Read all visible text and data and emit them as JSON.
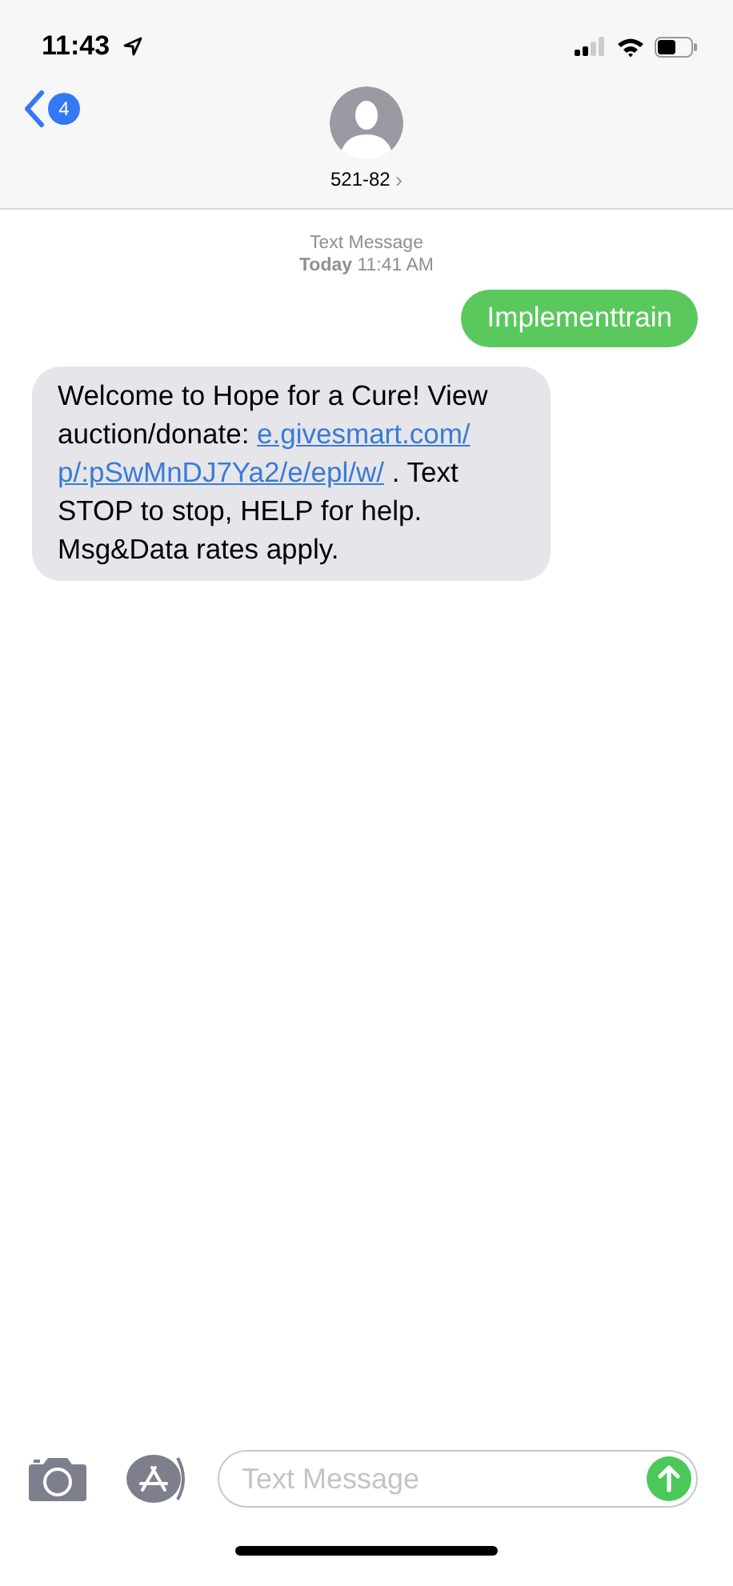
{
  "status_bar": {
    "time": "11:43"
  },
  "header": {
    "back_count": "4",
    "contact": "521-82",
    "chevron": "›"
  },
  "timestamp": {
    "service": "Text Message",
    "day": "Today",
    "time": "11:41 AM"
  },
  "messages": [
    {
      "kind": "sent",
      "parts": [
        {
          "kind": "text",
          "text": "Implementtrain"
        }
      ]
    },
    {
      "kind": "received",
      "parts": [
        {
          "kind": "text",
          "text": "Welcome to Hope for a Cure! View auction/donate: "
        },
        {
          "kind": "link",
          "text": "e.givesmart.com/"
        },
        {
          "kind": "link",
          "text": "p/:pSwMnDJ7Ya2/e/epl/w/"
        },
        {
          "kind": "text",
          "text": " . Text STOP to stop, HELP for help. Msg&Data rates apply."
        }
      ]
    }
  ],
  "composer": {
    "placeholder": "Text Message"
  }
}
